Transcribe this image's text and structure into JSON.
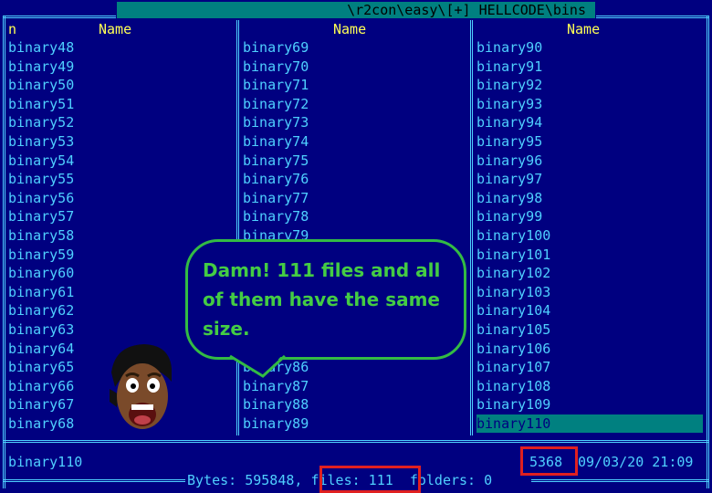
{
  "window": {
    "path": "\\r2con\\easy\\[+] HELLCODE\\bins"
  },
  "columns": [
    {
      "header_n": "n",
      "header": "Name",
      "items": [
        "binary48",
        "binary49",
        "binary50",
        "binary51",
        "binary52",
        "binary53",
        "binary54",
        "binary55",
        "binary56",
        "binary57",
        "binary58",
        "binary59",
        "binary60",
        "binary61",
        "binary62",
        "binary63",
        "binary64",
        "binary65",
        "binary66",
        "binary67",
        "binary68"
      ]
    },
    {
      "header": "Name",
      "items": [
        "binary69",
        "binary70",
        "binary71",
        "binary72",
        "binary73",
        "binary74",
        "binary75",
        "binary76",
        "binary77",
        "binary78",
        "binary79",
        "",
        "",
        "",
        "",
        "",
        "",
        "binary86",
        "binary87",
        "binary88",
        "binary89"
      ]
    },
    {
      "header": "Name",
      "items": [
        "binary90",
        "binary91",
        "binary92",
        "binary93",
        "binary94",
        "binary95",
        "binary96",
        "binary97",
        "binary98",
        "binary99",
        "binary100",
        "binary101",
        "binary102",
        "binary103",
        "binary104",
        "binary105",
        "binary106",
        "binary107",
        "binary108",
        "binary109",
        "binary110"
      ]
    }
  ],
  "selected_file": "binary110",
  "status": {
    "name": "binary110",
    "size": "5368",
    "datetime": "09/03/20 21:09"
  },
  "footer": {
    "bytes_label": "Bytes: 595848, ",
    "files_label": "files: 111",
    "folders_label": "  folders: 0"
  },
  "callout": {
    "text": "Damn! 111 files and all of them have the same size."
  },
  "colors": {
    "background": "#000080",
    "text": "#4fd0ff",
    "header": "#ffff55",
    "selection": "#008080",
    "highlight_box": "#e02020",
    "callout": "#44cc44"
  }
}
